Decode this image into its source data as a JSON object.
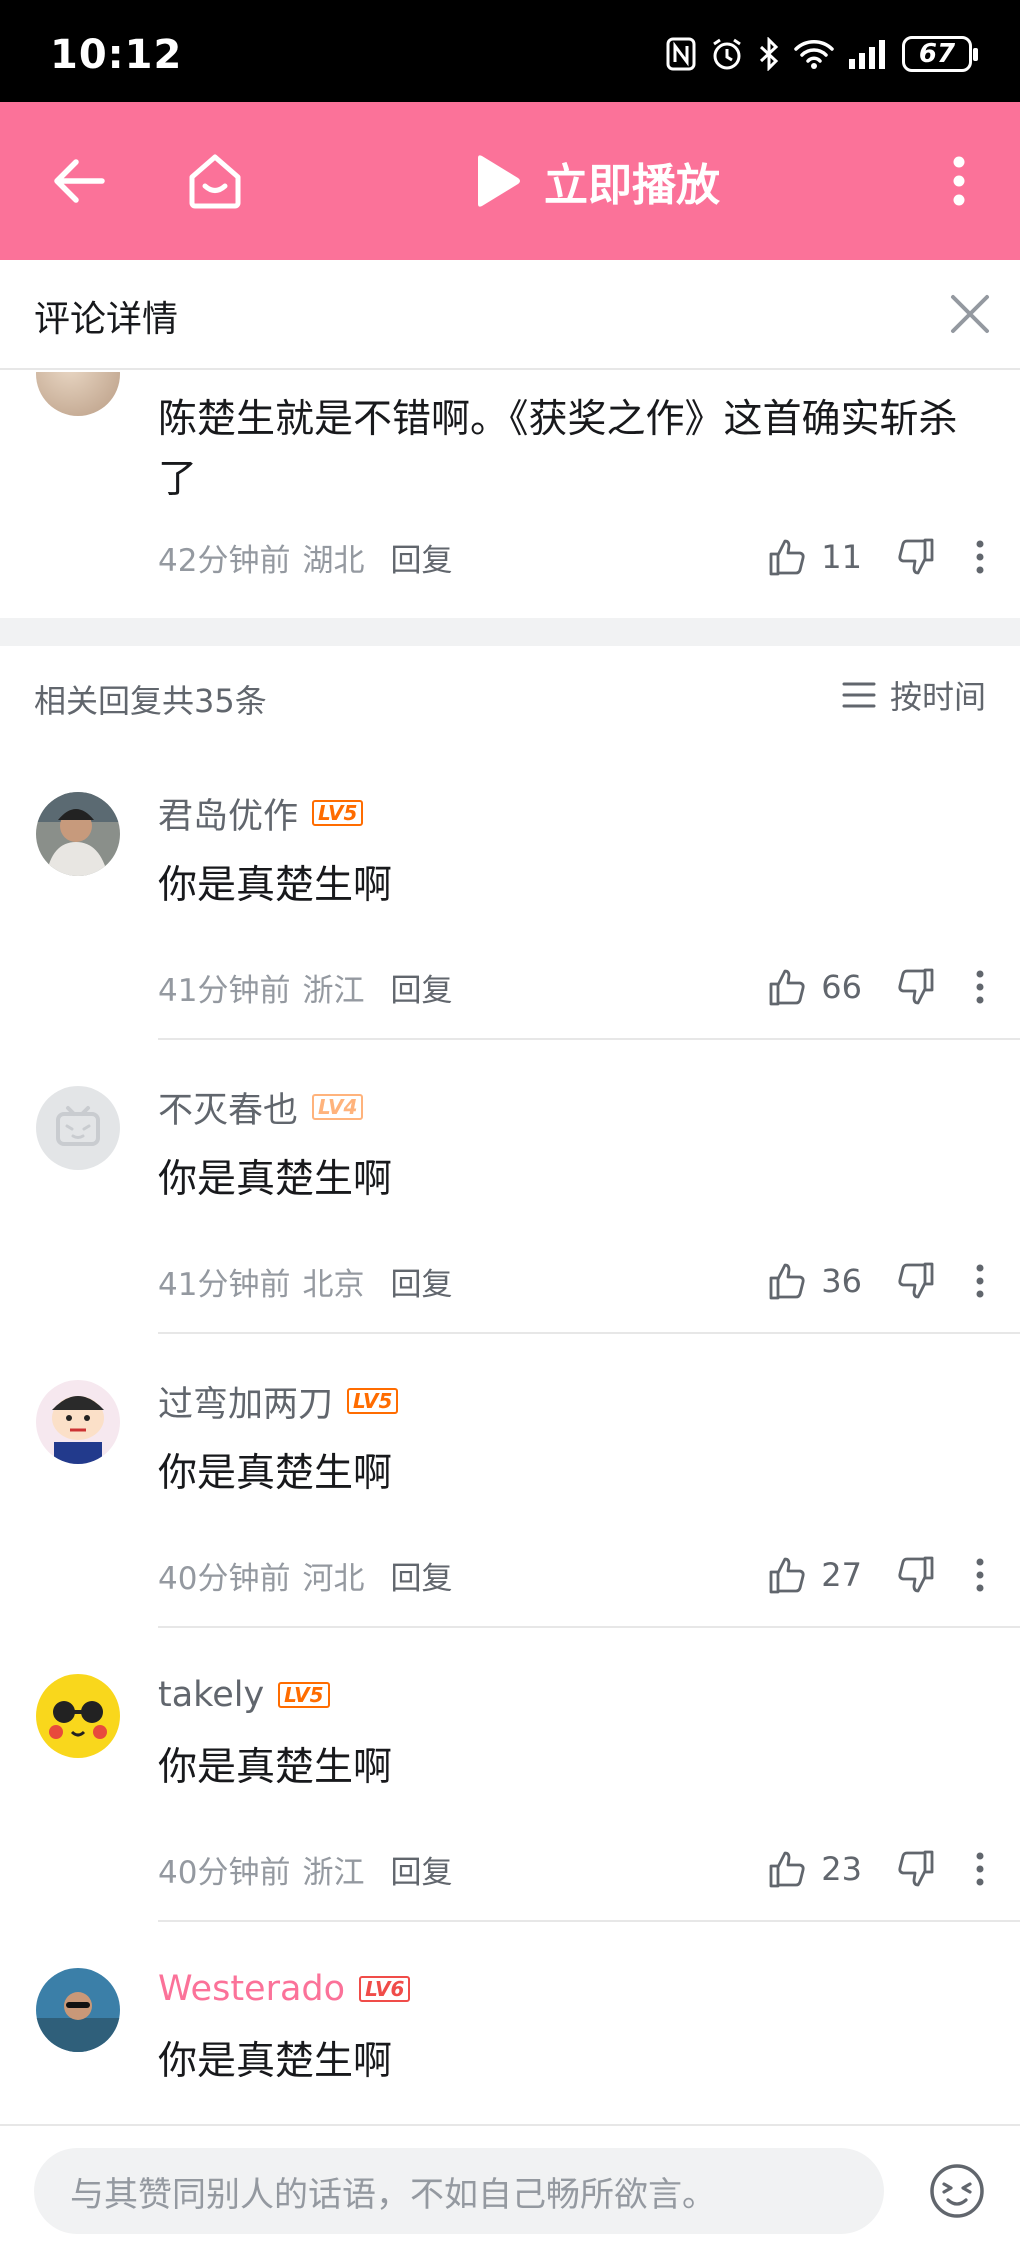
{
  "status_bar": {
    "time": "10:12",
    "battery": "67"
  },
  "app_bar": {
    "play_label": "立即播放"
  },
  "detail": {
    "title": "评论详情"
  },
  "main_comment": {
    "text": "陈楚生就是不错啊。《获奖之作》这首确实斩杀了",
    "time": "42分钟前",
    "location": "湖北",
    "reply_label": "回复",
    "likes": "11"
  },
  "replies_header": {
    "count_label": "相关回复共35条",
    "sort_label": "按时间"
  },
  "replies": [
    {
      "name": "君岛优作",
      "level": "LV5",
      "level_color": "#ff6c00",
      "content": "你是真楚生啊",
      "time": "41分钟前",
      "location": "浙江",
      "reply_label": "回复",
      "likes": "66"
    },
    {
      "name": "不灭春也",
      "level": "LV4",
      "level_color": "#ffb37c",
      "content": "你是真楚生啊",
      "time": "41分钟前",
      "location": "北京",
      "reply_label": "回复",
      "likes": "36"
    },
    {
      "name": "过弯加两刀",
      "level": "LV5",
      "level_color": "#ff6c00",
      "content": "你是真楚生啊",
      "time": "40分钟前",
      "location": "河北",
      "reply_label": "回复",
      "likes": "27"
    },
    {
      "name": "takely",
      "level": "LV5",
      "level_color": "#ff6c00",
      "content": "你是真楚生啊",
      "time": "40分钟前",
      "location": "浙江",
      "reply_label": "回复",
      "likes": "23"
    },
    {
      "name": "Westerado",
      "level": "LV6",
      "level_color": "#f04c49",
      "content": "你是真楚生啊",
      "time": "",
      "location": "",
      "reply_label": "",
      "likes": ""
    }
  ],
  "input_bar": {
    "placeholder": "与其赞同别人的话语，不如自己畅所欲言。"
  },
  "colors": {
    "brand_pink": "#fb7299",
    "text_primary": "#18191c",
    "text_secondary": "#61666d",
    "text_muted": "#9499a0"
  }
}
